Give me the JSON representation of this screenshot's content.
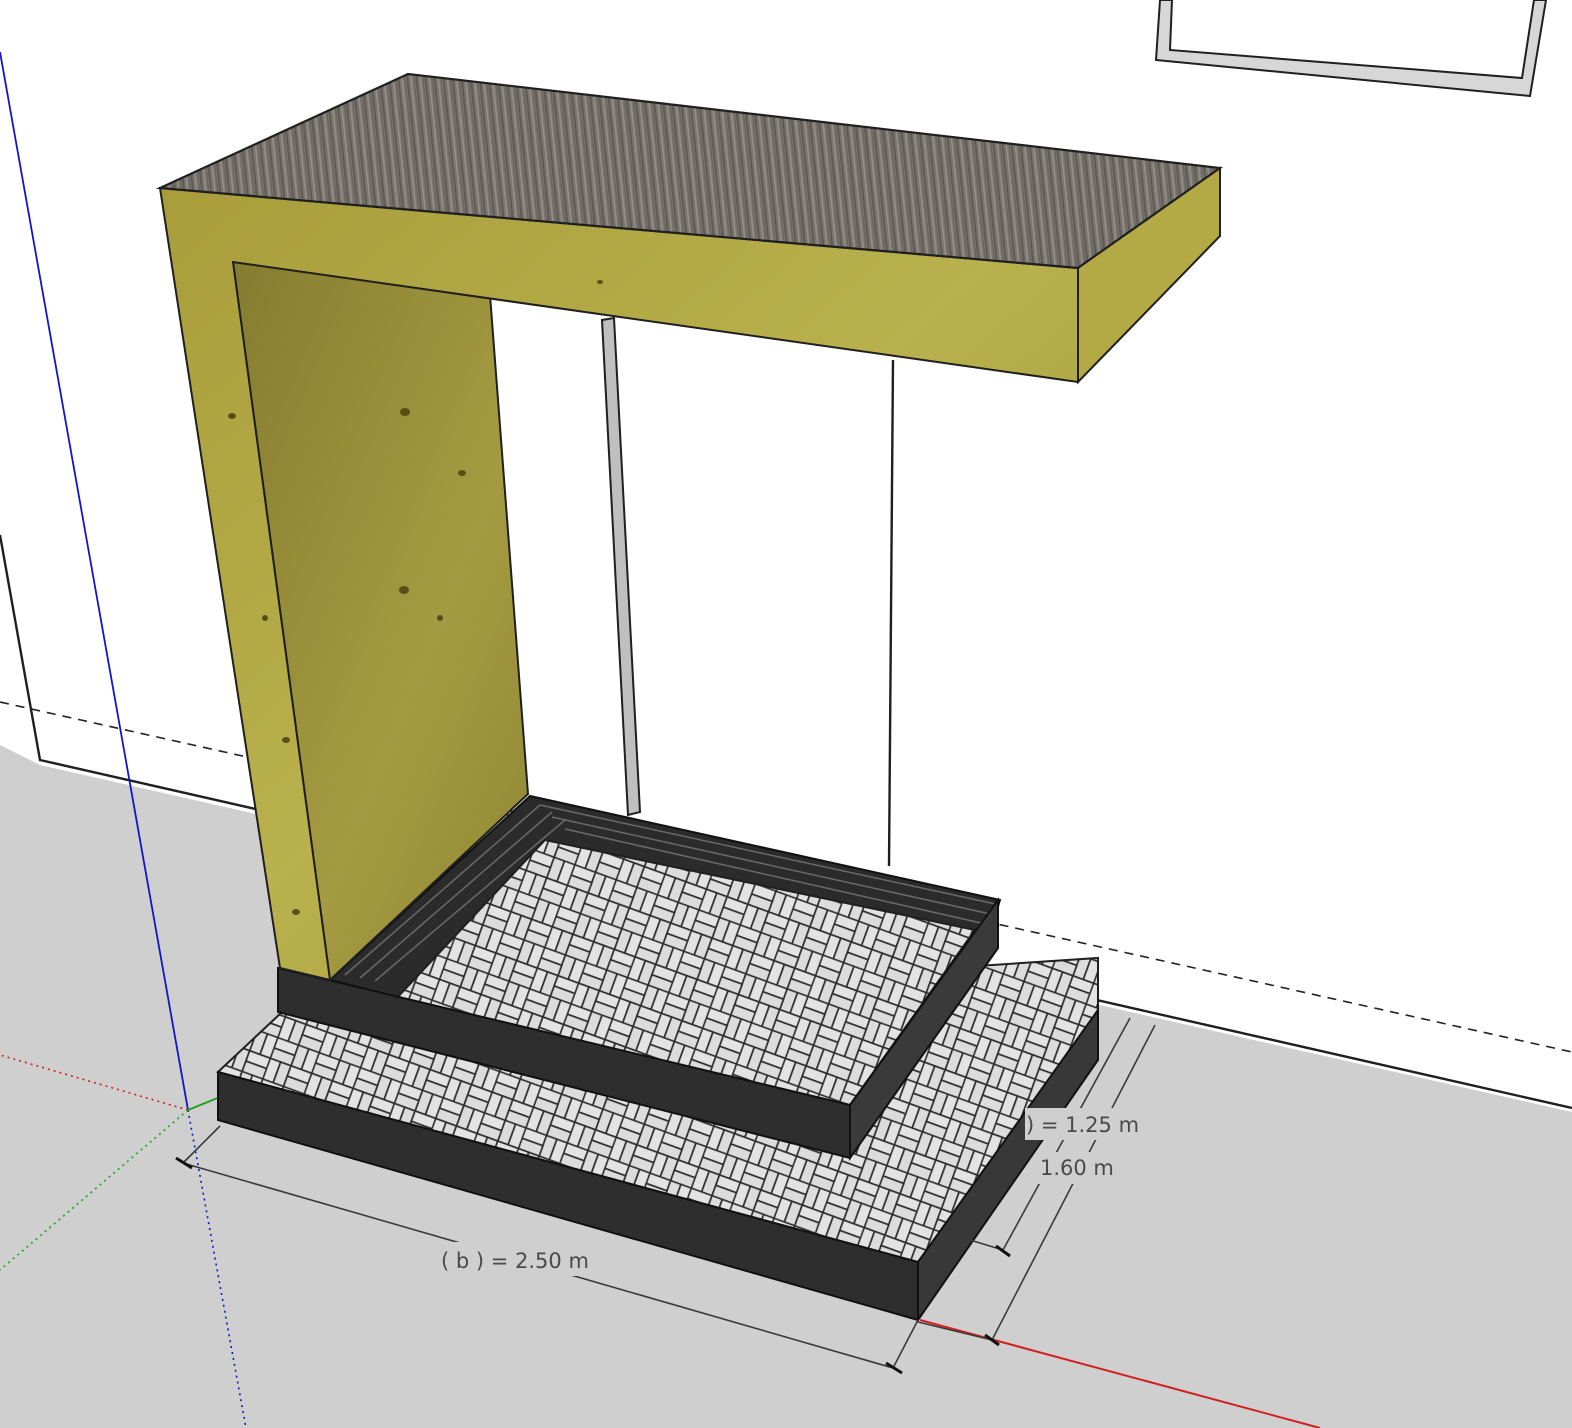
{
  "viewport": {
    "background": "#ffffff",
    "ground_color": "#cfcfcf"
  },
  "model": {
    "tabletop": {
      "material": "gray wood",
      "color": "#7d7870"
    },
    "support_panel": {
      "material": "yellow plywood",
      "color": "#b6ad48"
    },
    "steps": {
      "frame_color": "#2e2e2e",
      "tile_pattern": "herringbone",
      "tile_color": "#d8d8d8"
    }
  },
  "axes": {
    "red": "#d21f1f",
    "green": "#1aa31a",
    "blue": "#1414c8"
  },
  "dimensions": {
    "width_label": "( b ) = 2.50 m",
    "depth_upper_label": ") = 1.25 m",
    "depth_lower_label": "1.60 m"
  }
}
